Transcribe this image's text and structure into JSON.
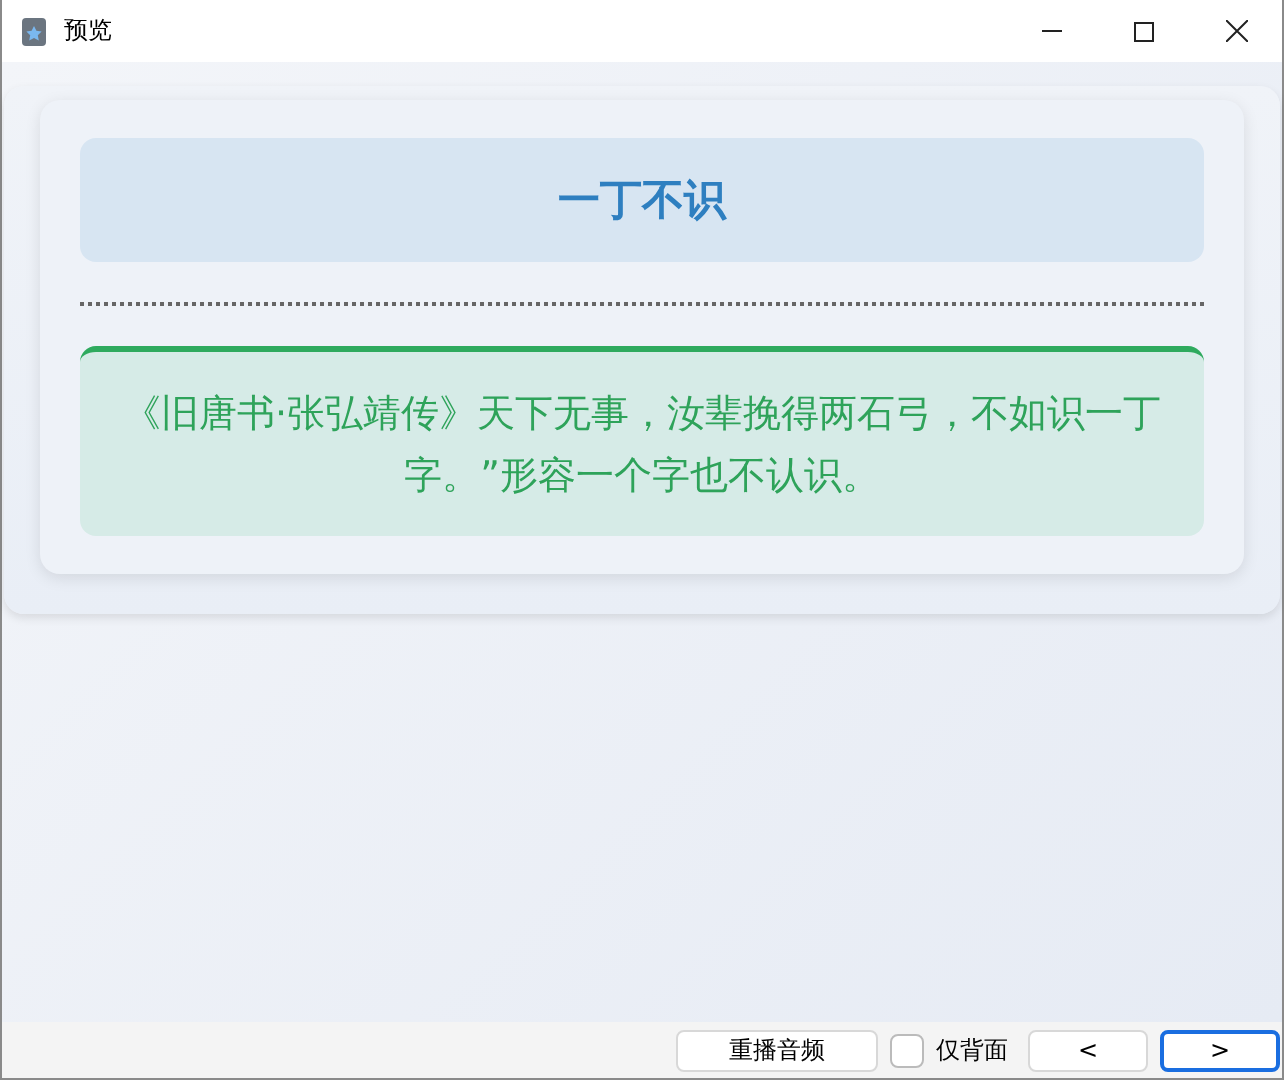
{
  "window": {
    "title": "预览"
  },
  "card": {
    "term": "一丁不识",
    "explanation": "《旧唐书·张弘靖传》天下无事，汝辈挽得两石弓，不如识一丁字。”形容一个字也不认识。"
  },
  "bottom_bar": {
    "replay_button": "重播音频",
    "back_only": {
      "label": "仅背面",
      "checked": false
    },
    "prev_button": "<",
    "next_button": ">"
  }
}
